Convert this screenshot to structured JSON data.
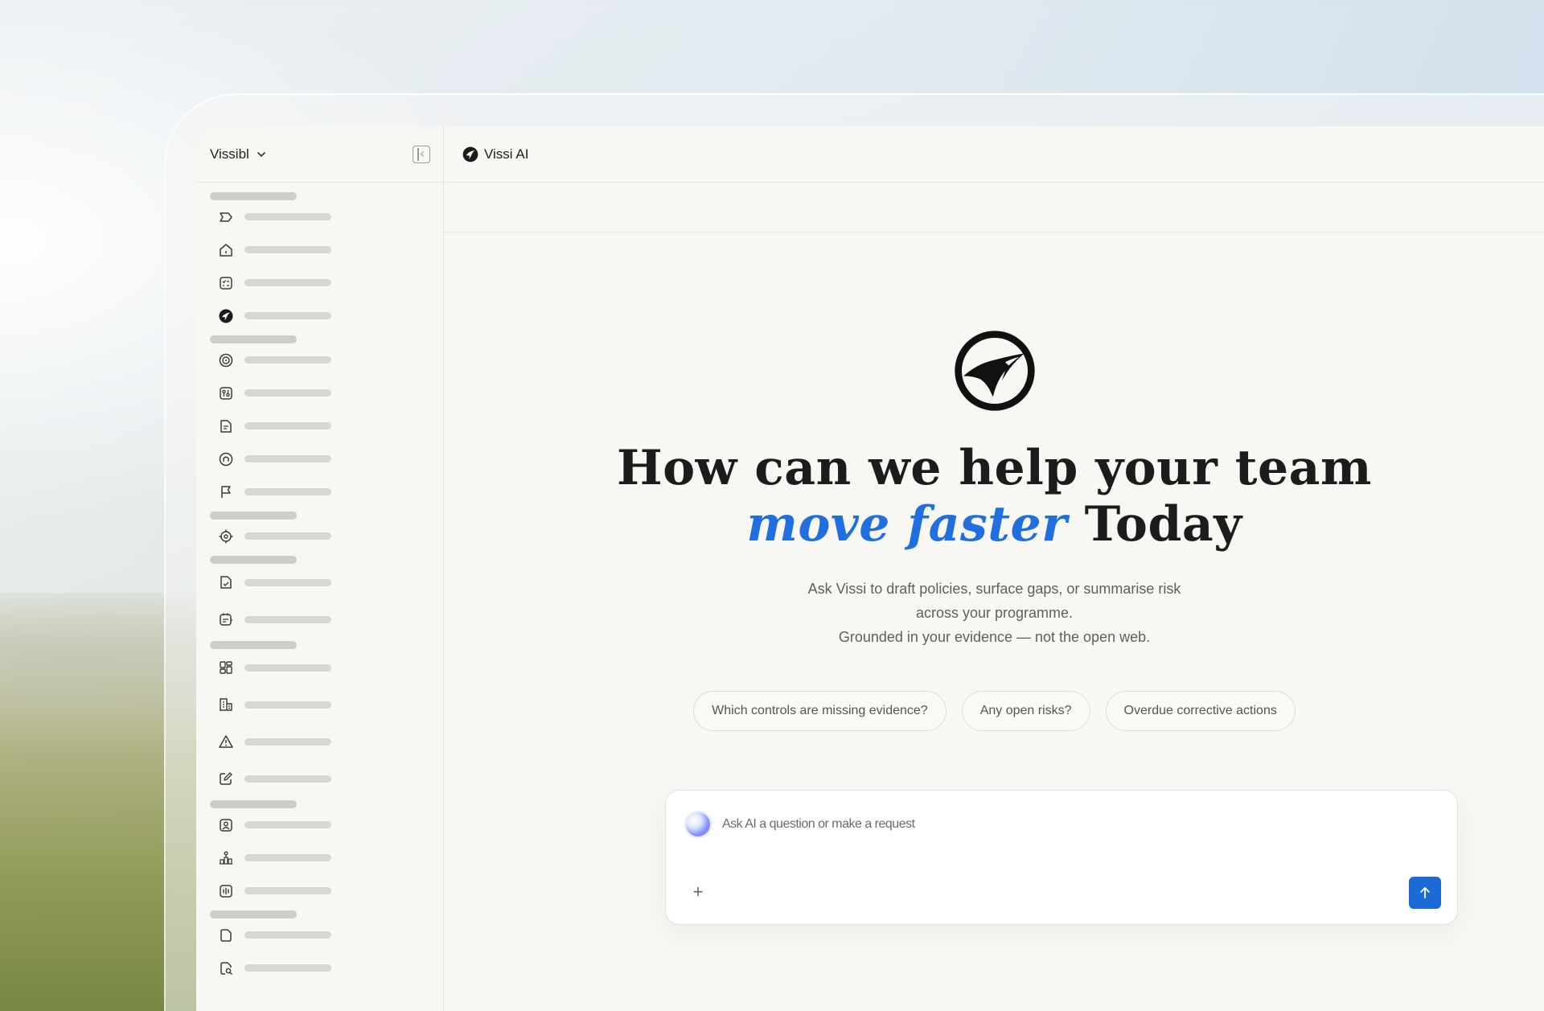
{
  "app": {
    "workspace_name": "Vissibl",
    "assistant_title": "Vissi AI"
  },
  "sidebar": {
    "groups": [
      {
        "items": [
          "tag-icon",
          "home-icon",
          "checklist-icon",
          "vissi-logo-icon"
        ]
      },
      {
        "items": [
          "target-refresh-icon",
          "controls-icon",
          "document-list-icon",
          "shield-circle-icon",
          "flag-icon"
        ]
      },
      {
        "items": [
          "crosshair-icon"
        ]
      },
      {
        "items": [
          "document-check-icon",
          "calendar-notes-icon"
        ]
      },
      {
        "items": [
          "dashboard-grid-icon",
          "building-icon",
          "warning-icon",
          "edit-icon"
        ]
      },
      {
        "items": [
          "user-card-icon",
          "org-chart-icon",
          "audio-icon"
        ]
      },
      {
        "items": [
          "file-icon",
          "file-search-icon"
        ]
      }
    ]
  },
  "hero": {
    "title_prefix": "How can we help your team ",
    "title_accent": "move faster",
    "title_suffix": " Today",
    "subtitle_line1": "Ask Vissi to draft policies, surface gaps, or summarise risk",
    "subtitle_line2": "across your programme.",
    "subtitle_line3": "Grounded in your evidence — not the open web."
  },
  "suggestions": [
    "Which controls are missing evidence?",
    "Any open risks?",
    "Overdue corrective actions"
  ],
  "composer": {
    "placeholder": "Ask AI a question or make a request",
    "plus_label": "+"
  },
  "colors": {
    "accent": "#1f6fe0",
    "send_button": "#1a6bd6",
    "background": "#f8f7f3"
  }
}
